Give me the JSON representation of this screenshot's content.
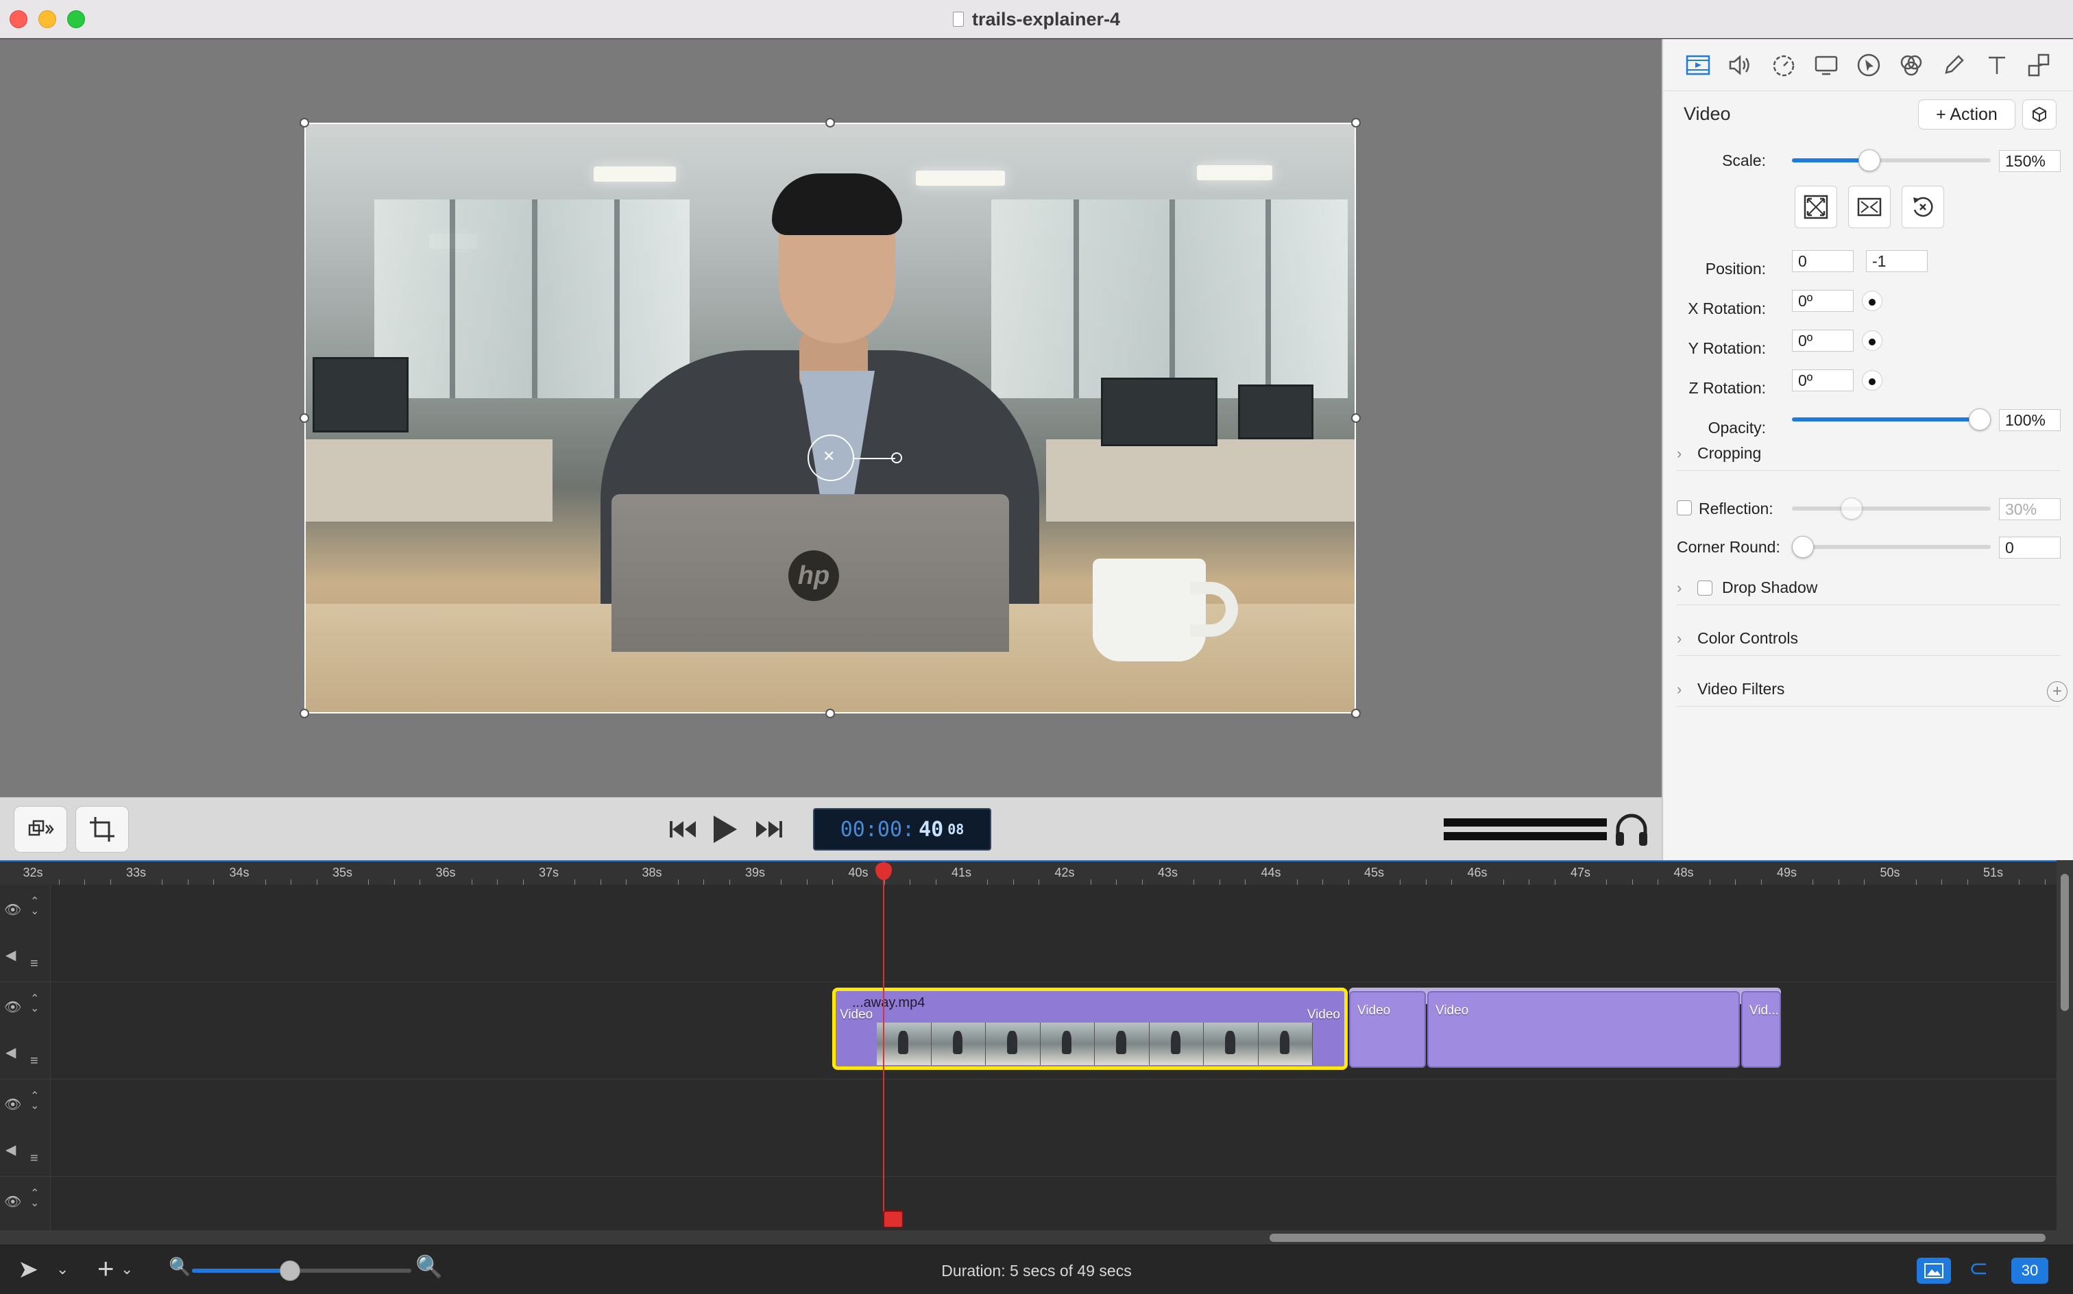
{
  "window": {
    "title": "trails-explainer-4"
  },
  "transport": {
    "timecode_main": "00:00:",
    "timecode_seconds": "40",
    "timecode_frames": "08"
  },
  "inspector": {
    "tabs": [
      "video-tab",
      "audio-tab",
      "timing-tab",
      "screen-tab",
      "cursor-tab",
      "filters-tab",
      "annotation-tab",
      "text-tab",
      "callout-tab"
    ],
    "heading": "Video",
    "action_label": "+ Action",
    "scale_label": "Scale:",
    "scale_value": "150%",
    "scale_level": 0.39,
    "position_label": "Position:",
    "position_x": "0",
    "position_y": "-1",
    "x_rotation_label": "X Rotation:",
    "x_rotation_value": "0º",
    "y_rotation_label": "Y Rotation:",
    "y_rotation_value": "0º",
    "z_rotation_label": "Z Rotation:",
    "z_rotation_value": "0º",
    "opacity_label": "Opacity:",
    "opacity_value": "100%",
    "opacity_level": 1.0,
    "cropping_label": "Cropping",
    "reflection_label": "Reflection:",
    "reflection_value": "30%",
    "reflection_level": 0.3,
    "corner_round_label": "Corner Round:",
    "corner_round_value": "0",
    "corner_round_level": 0.0,
    "drop_shadow_label": "Drop Shadow",
    "color_controls_label": "Color Controls",
    "video_filters_label": "Video Filters"
  },
  "timeline": {
    "ruler_ticks": [
      "32s",
      "33s",
      "34s",
      "35s",
      "36s",
      "37s",
      "38s",
      "39s",
      "40s",
      "41s",
      "42s",
      "43s",
      "44s",
      "45s",
      "46s",
      "47s",
      "48s",
      "49s",
      "50s",
      "51s"
    ],
    "selected_clip": {
      "name": "...away.mp4",
      "tag_left": "Video",
      "tag_right": "Video"
    },
    "clips": [
      {
        "tag": "Video"
      },
      {
        "tag": "Video"
      },
      {
        "tag": "Vid..."
      }
    ]
  },
  "status": {
    "duration": "Duration: 5 secs of 49 secs",
    "zoom_level": 0.45,
    "fps_badge": "30"
  },
  "colors": {
    "accent": "#1f7ae0",
    "selection": "#ffea00",
    "clip": "#9f8be0",
    "playhead": "#e02f2f"
  }
}
